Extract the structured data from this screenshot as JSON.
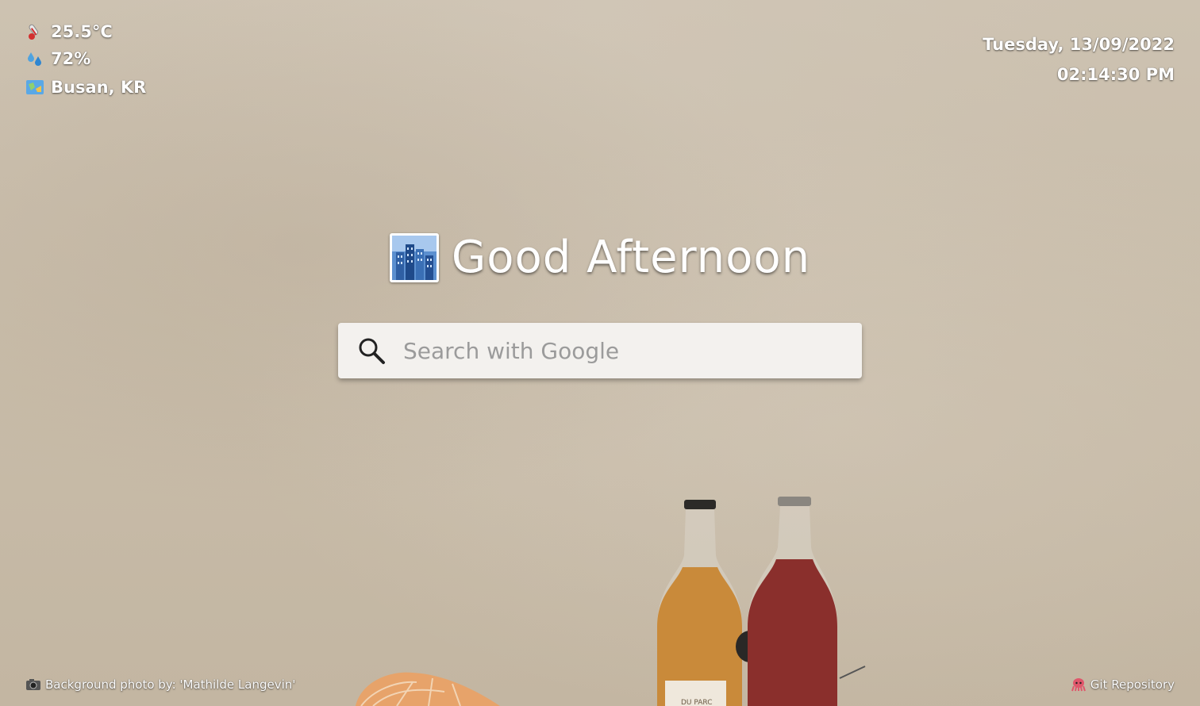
{
  "weather": {
    "temperature": "25.5°C",
    "temperature_icon": "thermometer-icon",
    "humidity": "72%",
    "humidity_icon": "droplets-icon",
    "location": "Busan, KR",
    "location_icon": "map-icon"
  },
  "clock": {
    "date": "Tuesday, 13/09/2022",
    "time": "02:14:30 PM"
  },
  "greeting": {
    "icon": "cityscape-icon",
    "text": "Good Afternoon"
  },
  "search": {
    "placeholder": "Search with Google",
    "value": "",
    "icon": "search-icon"
  },
  "footer": {
    "photo_credit": "Background photo by: 'Mathilde Langevin'",
    "photo_icon": "camera-icon",
    "repo_label": "Git Repository",
    "repo_icon": "octopus-icon"
  },
  "colors": {
    "background": "#c8bca9",
    "text": "#ffffff",
    "search_bg": "#f3f1ee",
    "placeholder": "#9b9b9b"
  }
}
